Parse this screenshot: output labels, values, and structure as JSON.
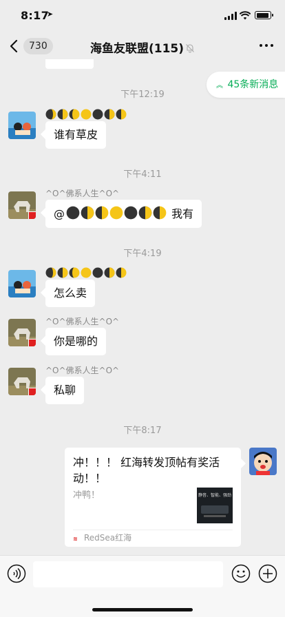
{
  "status_bar": {
    "time": "8:17"
  },
  "nav": {
    "back_count": "730",
    "title": "海鱼友联盟(115)"
  },
  "new_messages": {
    "label": "45条新消息"
  },
  "messages": {
    "t1": "下午12:19",
    "m1": {
      "sender_moons": [
        "waxing",
        "half-left",
        "half-right",
        "full",
        "new",
        "half-left",
        "half-right"
      ],
      "text": "谁有草皮"
    },
    "t2": "下午4:11",
    "m2": {
      "sender": "^O^佛系人生^O^",
      "prefix": "@",
      "suffix": " 我有",
      "moons": [
        "new",
        "half-left",
        "half-right",
        "full",
        "new",
        "half-left",
        "half-right"
      ]
    },
    "t3": "下午4:19",
    "m3": {
      "sender_moons": [
        "waxing",
        "half-left",
        "half-right",
        "full",
        "new",
        "half-left",
        "half-right"
      ],
      "text": "怎么卖"
    },
    "m4": {
      "sender": "^O^佛系人生^O^",
      "text": "你是哪的"
    },
    "m5": {
      "sender": "^O^佛系人生^O^",
      "text": "私聊"
    },
    "t4": "下午8:17",
    "m6": {
      "title": "冲！！！ 红海转发顶帖有奖活动！！",
      "desc": "冲鸭！",
      "source": "RedSea红海",
      "thumb_text": "静音、智能、强劲"
    }
  },
  "input": {
    "placeholder": ""
  },
  "colors": {
    "accent": "#06ad56",
    "background": "#ededed"
  }
}
